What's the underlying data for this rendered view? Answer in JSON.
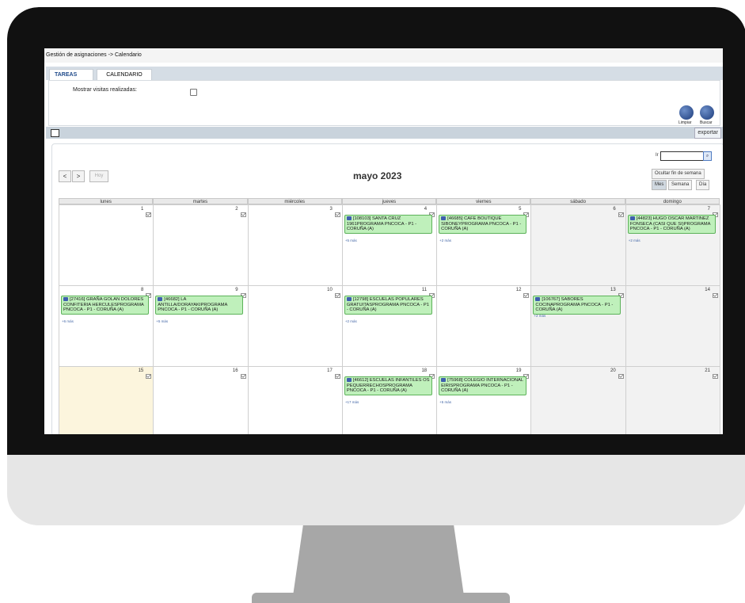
{
  "header": {
    "breadcrumb": "Gestión de asignaciones -> Calendario"
  },
  "tabs": [
    {
      "label": "TAREAS"
    },
    {
      "label": "CALENDARIO"
    }
  ],
  "filters": {
    "show_visits_label": "Mostrar visitas realizadas:"
  },
  "actions": {
    "clear_label": "Limpiar",
    "search_label": "Buscar",
    "export_label": "exportar"
  },
  "calendar": {
    "search_prefix": "Ir",
    "nav": {
      "prev": "<",
      "next": ">",
      "today": "Hoy"
    },
    "month_title": "mayo 2023",
    "hide_weekend": "Ocultar fin de semana",
    "views": [
      {
        "label": "Mes",
        "active": true
      },
      {
        "label": "Semana",
        "active": false
      },
      {
        "label": "Día",
        "active": false
      }
    ],
    "weekdays": [
      "lunes",
      "martes",
      "miércoles",
      "jueves",
      "viernes",
      "sábado",
      "domingo"
    ],
    "weeks": [
      [
        {
          "num": "1",
          "event": null,
          "more": ""
        },
        {
          "num": "2",
          "event": null,
          "more": ""
        },
        {
          "num": "3",
          "event": null,
          "more": ""
        },
        {
          "num": "4",
          "event": "[108103] SANTA CRUZ 1961PROGRAMA PNCOCA - P1 - CORUÑA (A)",
          "more": "+5 más"
        },
        {
          "num": "5",
          "event": "[46685] CAFE BOUTIQUE SIBONEYPROGRAMA PNCOCA - P1 - CORUÑA (A)",
          "more": "+2 más"
        },
        {
          "num": "6",
          "event": null,
          "more": ""
        },
        {
          "num": "7",
          "event": "[44823] HUGO OSCAR MARTINEZ FONSECA (CASI QUE SI)PROGRAMA PNCOCA - P1 - CORUÑA (A)",
          "more": "+2 más"
        }
      ],
      [
        {
          "num": "8",
          "event": "[27416] GRAÑA GOLAN DOLORES CONFITERIA HERCULESPROGRAMA PNCOCA - P1 - CORUÑA (A)",
          "more": "+6 más"
        },
        {
          "num": "9",
          "event": "[46682] LA ANTILLA/DORAYAKIPROGRAMA PNCOCA - P1 - CORUÑA (A)",
          "more": "+5 más"
        },
        {
          "num": "10",
          "event": null,
          "more": ""
        },
        {
          "num": "11",
          "event": "[12798] ESCUELAS POPULARES GRATUITASPROGRAMA PNCOCA - P1 - CORUÑA (A)",
          "more": "+2 más"
        },
        {
          "num": "12",
          "event": null,
          "more": ""
        },
        {
          "num": "13",
          "event": "[106767] SABORES COCINAPROGRAMA PNCOCA - P1 - CORUÑA (A)",
          "more": "+2 más"
        },
        {
          "num": "14",
          "event": null,
          "more": ""
        }
      ],
      [
        {
          "num": "15",
          "event": null,
          "more": ""
        },
        {
          "num": "16",
          "event": null,
          "more": ""
        },
        {
          "num": "17",
          "event": null,
          "more": ""
        },
        {
          "num": "18",
          "event": "[46612] ESCUELAS INFANTILES OS PEQUERRECHOSPROGRAMA PNCOCA - P1 - CORUÑA (A)",
          "more": "+17 más"
        },
        {
          "num": "19",
          "event": "[75968] COLEGIO INTERNACIONAL EIRISPROGRAMA PNCOCA - P1 - CORUÑA (A)",
          "more": "+5 más"
        },
        {
          "num": "20",
          "event": null,
          "more": ""
        },
        {
          "num": "21",
          "event": null,
          "more": ""
        }
      ]
    ]
  }
}
